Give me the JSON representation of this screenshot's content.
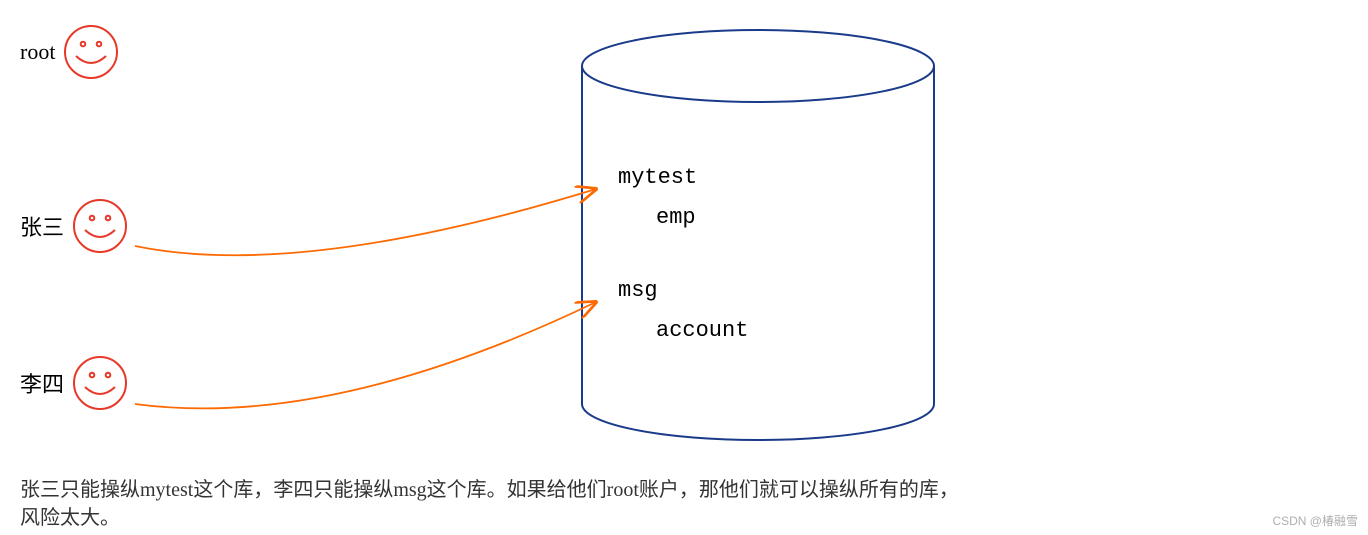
{
  "users": {
    "root": "root",
    "zhangsan": "张三",
    "lisi": "李四"
  },
  "database": {
    "schema1_name": "mytest",
    "schema1_table": "emp",
    "schema2_name": "msg",
    "schema2_table": "account"
  },
  "caption_line1": "张三只能操纵mytest这个库，李四只能操纵msg这个库。如果给他们root账户，那他们就可以操纵所有的库，",
  "caption_line2": "风险太大。",
  "watermark": "CSDN @椿融雪"
}
